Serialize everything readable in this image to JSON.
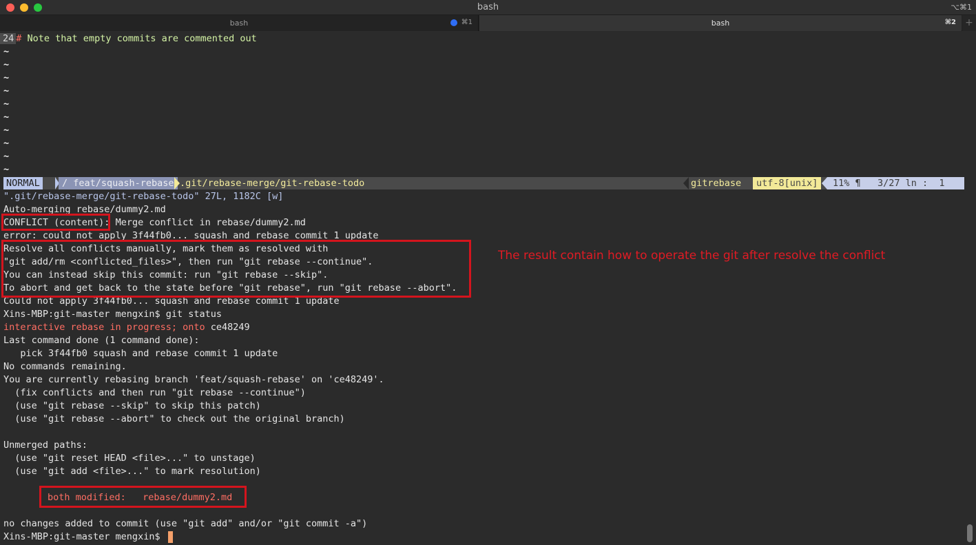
{
  "window": {
    "title": "bash",
    "shortcut": "⌥⌘1"
  },
  "tabs": [
    {
      "label": "bash",
      "shortcut": "⌘1",
      "active": false
    },
    {
      "label": "bash",
      "shortcut": "⌘2",
      "active": true
    }
  ],
  "tab_add_label": "+",
  "vim": {
    "line_number": "24",
    "line_hash": "#",
    "line_text": " Note that empty commits are commented out",
    "tilde": "~",
    "status": {
      "mode": "NORMAL",
      "branch": "/ feat/squash-rebase",
      "file": ".git/rebase-merge/git-rebase-todo",
      "filetype": "gitrebase",
      "encoding": "utf-8[unix]",
      "position": "11% ¶   3/27 ln :  1"
    },
    "file_message": "\".git/rebase-merge/git-rebase-todo\" 27L, 1182C [w]"
  },
  "terminal": {
    "auto_merging": "Auto-merging rebase/dummy2.md",
    "conflict_label": "CONFLICT (content):",
    "conflict_rest": " Merge conflict in rebase/dummy2.md",
    "error_line": "error: could not apply 3f44fb0... squash and rebase commit 1 update",
    "resolve_lines": [
      "Resolve all conflicts manually, mark them as resolved with",
      "\"git add/rm <conflicted_files>\", then run \"git rebase --continue\".",
      "You can instead skip this commit: run \"git rebase --skip\".",
      "To abort and get back to the state before \"git rebase\", run \"git rebase --abort\"."
    ],
    "could_not_apply": "Could not apply 3f44fb0... squash and rebase commit 1 update",
    "prompt_git_status": "Xins-MBP:git-master mengxin$ git status",
    "interactive_red": "interactive rebase in progress; onto",
    "interactive_hash": " ce48249",
    "status_lines": [
      "Last command done (1 command done):",
      "   pick 3f44fb0 squash and rebase commit 1 update",
      "No commands remaining.",
      "You are currently rebasing branch 'feat/squash-rebase' on 'ce48249'.",
      "  (fix conflicts and then run \"git rebase --continue\")",
      "  (use \"git rebase --skip\" to skip this patch)",
      "  (use \"git rebase --abort\" to check out the original branch)"
    ],
    "unmerged_lines": [
      "Unmerged paths:",
      "  (use \"git reset HEAD <file>...\" to unstage)",
      "  (use \"git add <file>...\" to mark resolution)"
    ],
    "both_modified": "both modified:   rebase/dummy2.md",
    "no_changes": "no changes added to commit (use \"git add\" and/or \"git commit -a\")",
    "final_prompt": "Xins-MBP:git-master mengxin$ "
  },
  "annotation": "The result contain how to operate the git after resolve the conflict",
  "colors": {
    "annotation": "#e01b24",
    "terminal_red": "#ff6e63",
    "comment_green": "#d4f3a5",
    "cursor": "#f5a06a"
  }
}
